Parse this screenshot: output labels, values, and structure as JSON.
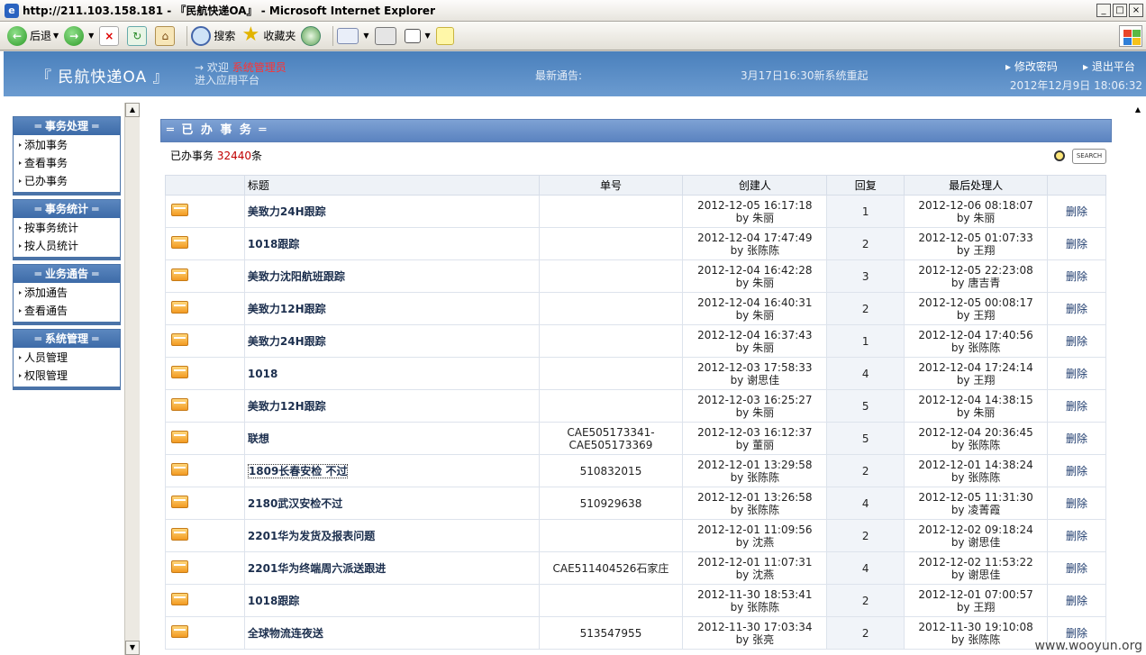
{
  "window": {
    "title": "http://211.103.158.181 - 『民航快递OA』 - Microsoft Internet Explorer",
    "controls": [
      "_",
      "□",
      "×"
    ]
  },
  "toolbar": {
    "back_label": "后退",
    "search_label": "搜索",
    "favorites_label": "收藏夹"
  },
  "header": {
    "logo": "『 民航快递OA 』",
    "welcome_prefix": "→ 欢迎",
    "user": "系统管理员",
    "enter_platform": "进入应用平台",
    "notice_label": "最新通告:",
    "notice_text": "3月17日16:30新系统重起",
    "change_pwd": "▸ 修改密码",
    "logout": "▸ 退出平台",
    "datetime": "2012年12月9日  18:06:32"
  },
  "sidebar": {
    "menus": [
      {
        "title": "═ 事务处理 ═",
        "items": [
          "添加事务",
          "查看事务",
          "已办事务"
        ]
      },
      {
        "title": "═ 事务统计 ═",
        "items": [
          "按事务统计",
          "按人员统计"
        ]
      },
      {
        "title": "═ 业务通告 ═",
        "items": [
          "添加通告",
          "查看通告"
        ]
      },
      {
        "title": "═ 系统管理 ═",
        "items": [
          "人员管理",
          "权限管理"
        ]
      }
    ]
  },
  "main": {
    "section_title": "═ 已 办 事 务 ═",
    "count_prefix": "已办事务",
    "count": "32440",
    "count_suffix": "条",
    "search_button": "SEARCH",
    "columns": [
      "",
      "标题",
      "单号",
      "创建人",
      "回复",
      "最后处理人",
      ""
    ],
    "rows": [
      {
        "title": "美致力24H跟踪",
        "no": "",
        "created": "2012-12-05 16:17:18",
        "creator": "by 朱丽",
        "replies": "1",
        "last": "2012-12-06 08:18:07",
        "last_by": "by 朱丽",
        "action": "删除"
      },
      {
        "title": "1018跟踪",
        "no": "",
        "created": "2012-12-04 17:47:49",
        "creator": "by 张陈陈",
        "replies": "2",
        "last": "2012-12-05 01:07:33",
        "last_by": "by 王翔",
        "action": "删除"
      },
      {
        "title": "美致力沈阳航班跟踪",
        "no": "",
        "created": "2012-12-04 16:42:28",
        "creator": "by 朱丽",
        "replies": "3",
        "last": "2012-12-05 22:23:08",
        "last_by": "by 唐吉青",
        "action": "删除"
      },
      {
        "title": "美致力12H跟踪",
        "no": "",
        "created": "2012-12-04 16:40:31",
        "creator": "by 朱丽",
        "replies": "2",
        "last": "2012-12-05 00:08:17",
        "last_by": "by 王翔",
        "action": "删除"
      },
      {
        "title": "美致力24H跟踪",
        "no": "",
        "created": "2012-12-04 16:37:43",
        "creator": "by 朱丽",
        "replies": "1",
        "last": "2012-12-04 17:40:56",
        "last_by": "by 张陈陈",
        "action": "删除"
      },
      {
        "title": "1018",
        "no": "",
        "created": "2012-12-03 17:58:33",
        "creator": "by 谢思佳",
        "replies": "4",
        "last": "2012-12-04 17:24:14",
        "last_by": "by 王翔",
        "action": "删除"
      },
      {
        "title": "美致力12H跟踪",
        "no": "",
        "created": "2012-12-03 16:25:27",
        "creator": "by 朱丽",
        "replies": "5",
        "last": "2012-12-04 14:38:15",
        "last_by": "by 朱丽",
        "action": "删除"
      },
      {
        "title": "联想",
        "no": "CAE505173341-",
        "no2": "CAE505173369",
        "created": "2012-12-03 16:12:37",
        "creator": "by 董丽",
        "replies": "5",
        "last": "2012-12-04 20:36:45",
        "last_by": "by 张陈陈",
        "action": "删除"
      },
      {
        "title": "1809长春安检 不过",
        "no": "510832015",
        "created": "2012-12-01 13:29:58",
        "creator": "by 张陈陈",
        "replies": "2",
        "last": "2012-12-01 14:38:24",
        "last_by": "by 张陈陈",
        "action": "删除"
      },
      {
        "title": "2180武汉安检不过",
        "no": "510929638",
        "created": "2012-12-01 13:26:58",
        "creator": "by 张陈陈",
        "replies": "4",
        "last": "2012-12-05 11:31:30",
        "last_by": "by 凌菁霞",
        "action": "删除"
      },
      {
        "title": "2201华为发货及报表问题",
        "no": "",
        "created": "2012-12-01 11:09:56",
        "creator": "by 沈燕",
        "replies": "2",
        "last": "2012-12-02 09:18:24",
        "last_by": "by 谢思佳",
        "action": "删除"
      },
      {
        "title": "2201华为终端周六派送跟进",
        "no": "CAE511404526石家庄",
        "created": "2012-12-01 11:07:31",
        "creator": "by 沈燕",
        "replies": "4",
        "last": "2012-12-02 11:53:22",
        "last_by": "by 谢思佳",
        "action": "删除"
      },
      {
        "title": "1018跟踪",
        "no": "",
        "created": "2012-11-30 18:53:41",
        "creator": "by 张陈陈",
        "replies": "2",
        "last": "2012-12-01 07:00:57",
        "last_by": "by 王翔",
        "action": "删除"
      },
      {
        "title": "全球物流连夜送",
        "no": "513547955",
        "created": "2012-11-30 17:03:34",
        "creator": "by 张亮",
        "replies": "2",
        "last": "2012-11-30 19:10:08",
        "last_by": "by 张陈陈",
        "action": "删除"
      }
    ]
  },
  "watermark": "www.wooyun.org"
}
